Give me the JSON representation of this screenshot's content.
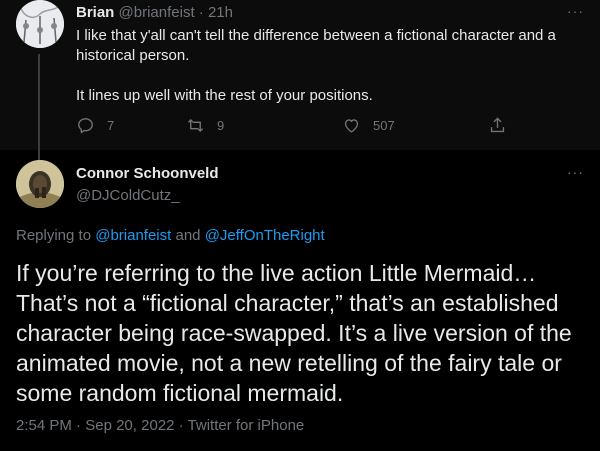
{
  "parent_tweet": {
    "name": "Brian",
    "handle": "@brianfeist",
    "time": "21h",
    "more": "···",
    "text_1": "I like that y'all can't tell the difference between a fictional character and a historical person.",
    "text_2": "It lines up well with the rest of your positions.",
    "reply_count": "7",
    "retweet_count": "9",
    "like_count": "507"
  },
  "main_tweet": {
    "name": "Connor Schoonveld",
    "handle": "@DJColdCutz_",
    "more": "···",
    "replying_to_label": "Replying to ",
    "reply_mention_1": "@brianfeist",
    "reply_and": " and ",
    "reply_mention_2": "@JeffOnTheRight",
    "text": "If you’re referring to the live action Little Mermaid… That’s not a “fictional character,” that’s an established character being race-swapped. It’s a live version of the animated movie, not a new retelling of the fairy tale or some random fictional mermaid.",
    "time": "2:54 PM",
    "date": "Sep 20, 2022",
    "source": "Twitter for iPhone",
    "separator": " · "
  },
  "colors": {
    "background": "#000000",
    "parent_background": "#0c0c0c",
    "text": "#e7e9ea",
    "muted": "#71767b",
    "link": "#1d9bf0"
  },
  "icons": [
    "reply-icon",
    "retweet-icon",
    "like-icon",
    "share-icon",
    "more-icon"
  ]
}
